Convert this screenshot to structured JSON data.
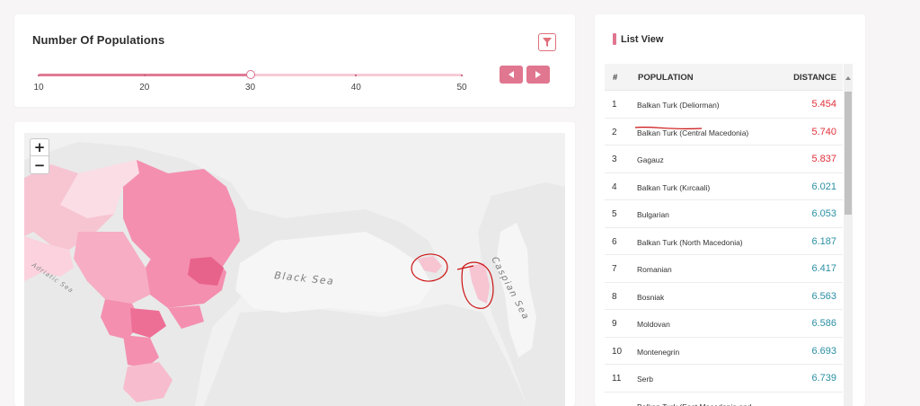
{
  "slider_card": {
    "title": "Number Of Populations",
    "ticks": [
      "10",
      "20",
      "30",
      "40",
      "50"
    ],
    "min": 10,
    "max": 50,
    "value": 30,
    "icons": {
      "filter": "filter-icon",
      "prev": "arrow-left-icon",
      "next": "arrow-right-icon"
    }
  },
  "map": {
    "labels": {
      "black_sea": "Black Sea",
      "caspian_sea": "Caspian Sea",
      "adriatic_sea": "Adriatic Sea"
    },
    "zoom_in": "+",
    "zoom_out": "−"
  },
  "list": {
    "title": "List View",
    "headers": {
      "index": "#",
      "population": "POPULATION",
      "distance": "DISTANCE"
    },
    "rows": [
      {
        "index": "1",
        "population": "Balkan Turk (Deliorman)",
        "distance": "5.454",
        "color": "#e0303a"
      },
      {
        "index": "2",
        "population": "Balkan Turk (Central Macedonia)",
        "distance": "5.740",
        "color": "#e0303a"
      },
      {
        "index": "3",
        "population": "Gagauz",
        "distance": "5.837",
        "color": "#e0303a"
      },
      {
        "index": "4",
        "population": "Balkan Turk (Kırcaali)",
        "distance": "6.021",
        "color": "#2a8fa3"
      },
      {
        "index": "5",
        "population": "Bulgarian",
        "distance": "6.053",
        "color": "#2a8fa3"
      },
      {
        "index": "6",
        "population": "Balkan Turk (North Macedonia)",
        "distance": "6.187",
        "color": "#2a8fa3"
      },
      {
        "index": "7",
        "population": "Romanian",
        "distance": "6.417",
        "color": "#2a8fa3"
      },
      {
        "index": "8",
        "population": "Bosniak",
        "distance": "6.563",
        "color": "#2a8fa3"
      },
      {
        "index": "9",
        "population": "Moldovan",
        "distance": "6.586",
        "color": "#2a8fa3"
      },
      {
        "index": "10",
        "population": "Montenegrin",
        "distance": "6.693",
        "color": "#2a8fa3"
      },
      {
        "index": "11",
        "population": "Serb",
        "distance": "6.739",
        "color": "#2a8fa3"
      },
      {
        "index": "",
        "population": "Balkan Turk (East Macedonia and",
        "distance": "",
        "color": "#2a8fa3"
      }
    ]
  },
  "colors": {
    "accent": "#e0768f",
    "near": "#e0303a",
    "far": "#2a8fa3",
    "annotation": "#cc1111"
  }
}
